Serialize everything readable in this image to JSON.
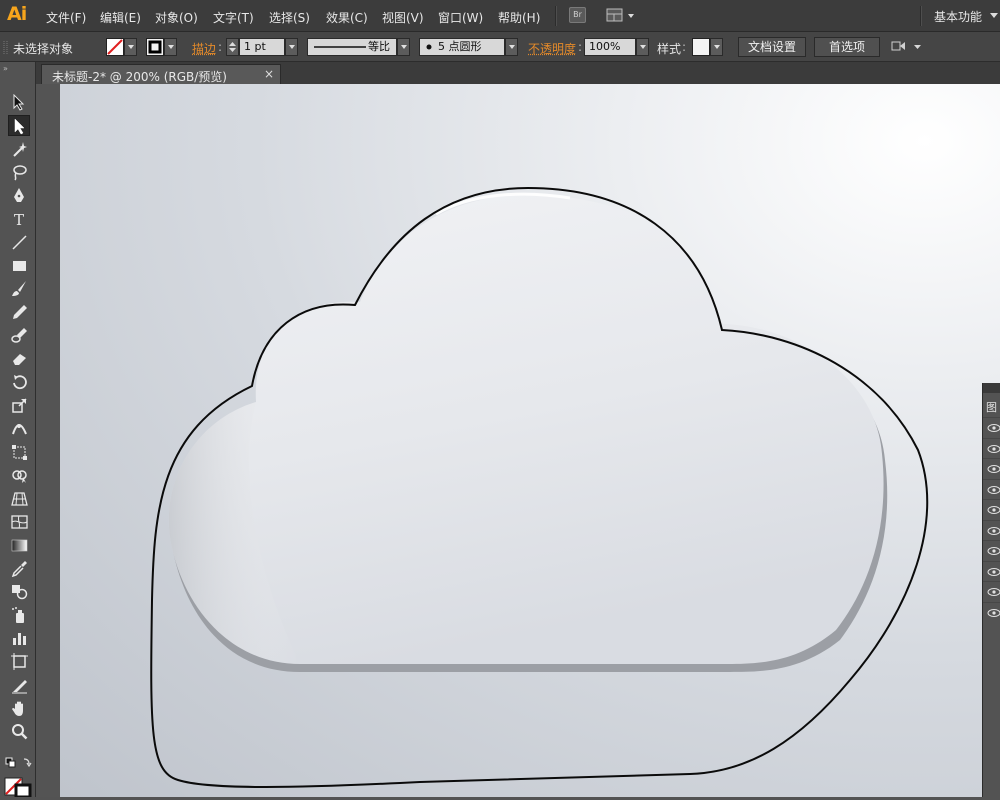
{
  "app": {
    "logo": "Ai"
  },
  "menu": [
    {
      "label": "文件(F)",
      "name": "menu-file"
    },
    {
      "label": "编辑(E)",
      "name": "menu-edit"
    },
    {
      "label": "对象(O)",
      "name": "menu-object"
    },
    {
      "label": "文字(T)",
      "name": "menu-type"
    },
    {
      "label": "选择(S)",
      "name": "menu-select"
    },
    {
      "label": "效果(C)",
      "name": "menu-effect"
    },
    {
      "label": "视图(V)",
      "name": "menu-view"
    },
    {
      "label": "窗口(W)",
      "name": "menu-window"
    },
    {
      "label": "帮助(H)",
      "name": "menu-help"
    }
  ],
  "bridge_label": "Br",
  "workspace": {
    "label": "基本功能"
  },
  "control": {
    "selection_status": "未选择对象",
    "stroke_label": "描边",
    "stroke_weight": "1 pt",
    "profile_label": "等比",
    "brush_label": "5 点圆形",
    "opacity_label": "不透明度",
    "opacity_value": "100%",
    "style_label": "样式",
    "doc_setup_button": "文档设置",
    "preferences_button": "首选项"
  },
  "document": {
    "tab_title": "未标题-2* @ 200% (RGB/预览)",
    "close_glyph": "×"
  },
  "right_panel": {
    "tab_label": "图",
    "rows": 10
  },
  "colors": {
    "accent": "#f7a51c",
    "stroke_label": "#e48a2a",
    "ui_dark": "#3c3c3c",
    "canvas_light": "#eceef1"
  },
  "tools": [
    "selection-tool-icon",
    "direct-selection-tool-icon",
    "magic-wand-tool-icon",
    "lasso-tool-icon",
    "pen-tool-icon",
    "type-tool-icon",
    "line-segment-tool-icon",
    "rectangle-tool-icon",
    "paintbrush-tool-icon",
    "pencil-tool-icon",
    "blob-brush-tool-icon",
    "eraser-tool-icon",
    "rotate-tool-icon",
    "scale-tool-icon",
    "width-tool-icon",
    "free-transform-tool-icon",
    "shape-builder-tool-icon",
    "perspective-grid-tool-icon",
    "mesh-tool-icon",
    "gradient-tool-icon",
    "eyedropper-tool-icon",
    "blend-tool-icon",
    "symbol-sprayer-tool-icon",
    "column-graph-tool-icon",
    "artboard-tool-icon",
    "slice-tool-icon",
    "hand-tool-icon",
    "zoom-tool-icon"
  ]
}
